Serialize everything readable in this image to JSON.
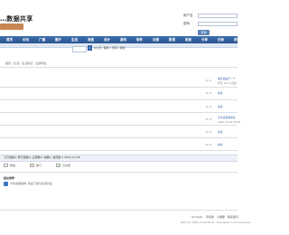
{
  "header": {
    "banner_text": "…数据共享",
    "login": {
      "username_label": "用户名",
      "password_label": "密码",
      "submit_label": "登录"
    }
  },
  "nav": {
    "items": [
      "首页",
      "论坛",
      "广播",
      "圈子",
      "生活",
      "淘宝",
      "设计",
      "游戏",
      "软件",
      "动漫",
      "影视",
      "家居",
      "分享",
      "记录",
      "排行榜"
    ]
  },
  "breadcrumb": "首页 › 生活 › 生活杂记 › 主题列表",
  "pager": {
    "page_number": "1",
    "text": "共1页 / 跳转 / 页码 / 刷新"
  },
  "threads": [
    {
      "num": "0 / 1",
      "name": "电影自由行一个",
      "sub": "昨天 10:14 回复"
    },
    {
      "num": "0 / 1",
      "name": "未来",
      "sub": ""
    },
    {
      "num": "0 / 1",
      "name": "未来",
      "sub": ""
    },
    {
      "num": "0 / 1",
      "name": "分享资源发布者",
      "sub": "2020-11-16 09:00"
    },
    {
      "num": "0 / 1",
      "name": "未来",
      "sub": ""
    },
    {
      "num": "0 / 1",
      "name": "未来",
      "sub": ""
    }
  ],
  "stats": "今日发帖0, 昨日发帖0, 主题数0, 帖数0, 会员数 0 2019-12-26",
  "legend": [
    "新帖",
    "热门",
    "已关闭"
  ],
  "section": {
    "title": "相关推荐",
    "reference": "分享资源发布, 欢迎下载与交流讨论"
  },
  "footer": {
    "links": [
      "Archiver",
      "手机版",
      "小黑屋",
      "联系我们"
    ],
    "copyright": "GMT+8, 2020-11-16 09:21 , Processed in 0.0 second(s)"
  }
}
